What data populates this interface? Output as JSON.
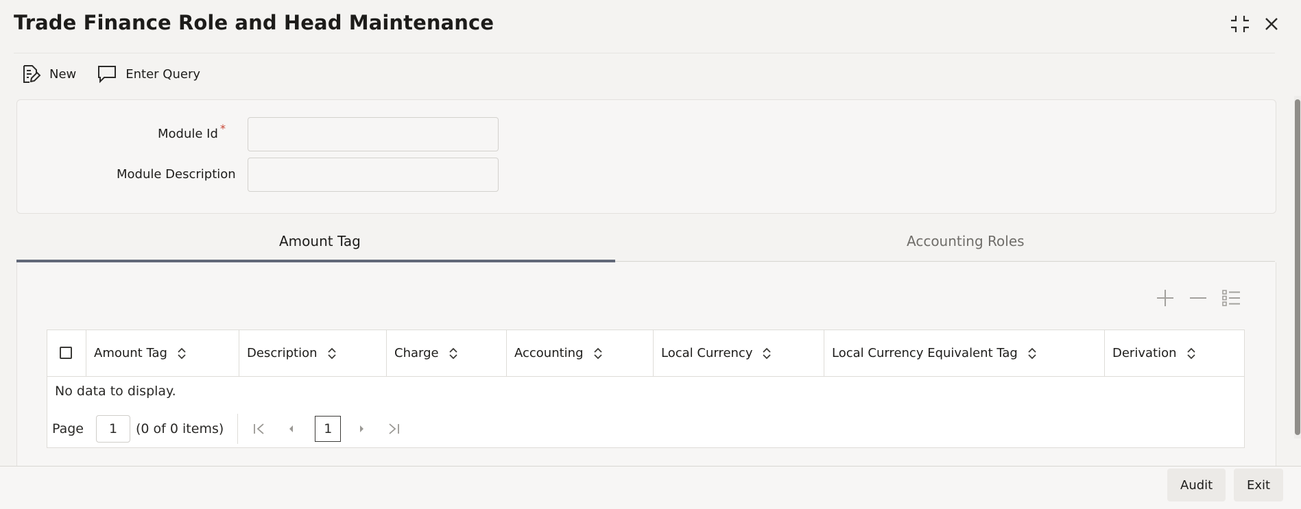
{
  "window": {
    "title": "Trade Finance Role and Head Maintenance",
    "maximize_icon": "maximize-icon",
    "close_icon": "close-icon"
  },
  "toolbar": {
    "new_label": "New",
    "enter_query_label": "Enter Query"
  },
  "form": {
    "module_id_label": "Module Id",
    "required_mark": "*",
    "module_id_value": "",
    "module_description_label": "Module Description",
    "module_description_value": ""
  },
  "tabs": [
    {
      "label": "Amount Tag",
      "active": true
    },
    {
      "label": "Accounting Roles",
      "active": false
    }
  ],
  "grid": {
    "actions": [
      "add-icon",
      "remove-icon",
      "list-icon"
    ],
    "columns": [
      "Amount Tag",
      "Description",
      "Charge",
      "Accounting",
      "Local Currency",
      "Local Currency Equivalent Tag",
      "Derivation"
    ],
    "rows": [],
    "empty_message": "No data to display.",
    "pager": {
      "page_label": "Page",
      "page_value": "1",
      "items_text": "(0 of 0 items)",
      "current_page": "1"
    }
  },
  "footer": {
    "audit_label": "Audit",
    "exit_label": "Exit"
  },
  "colors": {
    "accent_underline": "#616878",
    "required": "#c74634"
  }
}
